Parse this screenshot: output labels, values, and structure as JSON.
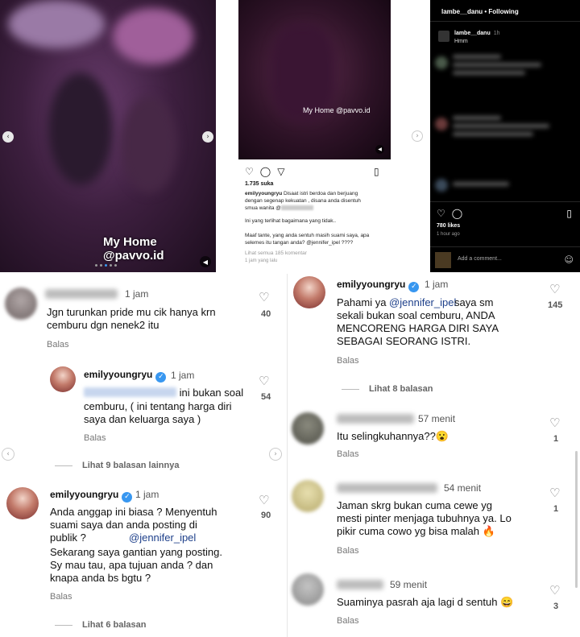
{
  "post1": {
    "caption": "My Home @pavvo.id"
  },
  "post2": {
    "video_caption": "My Home @pavvo.id",
    "likes": "1.735 suka",
    "caption_user": "emilyyoungryu",
    "caption_line1": "Disaat istri berdoa dan berjuang",
    "caption_line2": "dengan segenap kekuatan , disana anda disentuh",
    "caption_line3": "smua wanita @",
    "caption_line4": "Ini yang terlihat bagaimana yang tidak..",
    "caption_line5": "Maaf tante, yang anda sentuh masih suami saya, apa",
    "caption_line6": "selemes itu tangan anda? @jennifer_ipel ????",
    "view_comments": "Lihat semua 185 komentar",
    "time": "1 jam yang lalu"
  },
  "post3": {
    "header": "lambe__danu • Following",
    "username": "lambe__danu",
    "time": "1h",
    "caption": "Hmm",
    "likes": "780 likes",
    "posted": "1 hour ago",
    "add_comment": "Add a comment..."
  },
  "left_comments": {
    "c1": {
      "time": "1 jam",
      "text": "Jgn turunkan pride mu cik hanya krn\ncemburu dgn nenek2 itu",
      "likes": "40",
      "reply": "Balas"
    },
    "c2": {
      "user": "emilyyoungryu",
      "time": "1 jam",
      "text_tail": "ini bukan soal",
      "text_rest": "cemburu, ( ini tentang harga diri\nsaya dan keluarga saya )",
      "likes": "54",
      "reply": "Balas"
    },
    "more1": "Lihat 9 balasan lainnya",
    "c3": {
      "user": "emilyyoungryu",
      "time": "1 jam",
      "text_a": "Anda anggap ini biasa ? Menyentuh\nsuami saya dan anda posting di\npublik ?",
      "mention": "@jennifer_ipel",
      "text_b": "Sekarang saya gantian yang posting.\nSy mau tau, apa tujuan anda ? dan\nknapa anda bs bgtu ?",
      "likes": "90",
      "reply": "Balas"
    },
    "more2": "Lihat 6 balasan"
  },
  "right_comments": {
    "c1": {
      "user": "emilyyoungryu",
      "time": "1 jam",
      "text_a": "Pahami ya",
      "mention": "@jennifer_ipel",
      "text_b": "saya sm\nsekali bukan soal cemburu, ANDA\nMENCORENG HARGA DIRI SAYA\nSEBAGAI SEORANG ISTRI.",
      "likes": "145",
      "reply": "Balas"
    },
    "more1": "Lihat 8 balasan",
    "c2": {
      "time": "57 menit",
      "text": "Itu selingkuhannya??😮",
      "likes": "1",
      "reply": "Balas"
    },
    "c3": {
      "time": "54 menit",
      "text": "Jaman skrg bukan cuma cewe yg\nmesti pinter menjaga tubuhnya ya. Lo\npikir cuma cowo yg bisa malah 🔥",
      "likes": "1",
      "reply": "Balas"
    },
    "c4": {
      "time": "59 menit",
      "text": "Suaminya pasrah aja lagi d sentuh 😄",
      "likes": "3",
      "reply": "Balas"
    }
  },
  "icons": {
    "heart": "♡",
    "comment": "◯",
    "send": "▽",
    "bookmark": "⛉",
    "left": "‹",
    "right": "›"
  }
}
